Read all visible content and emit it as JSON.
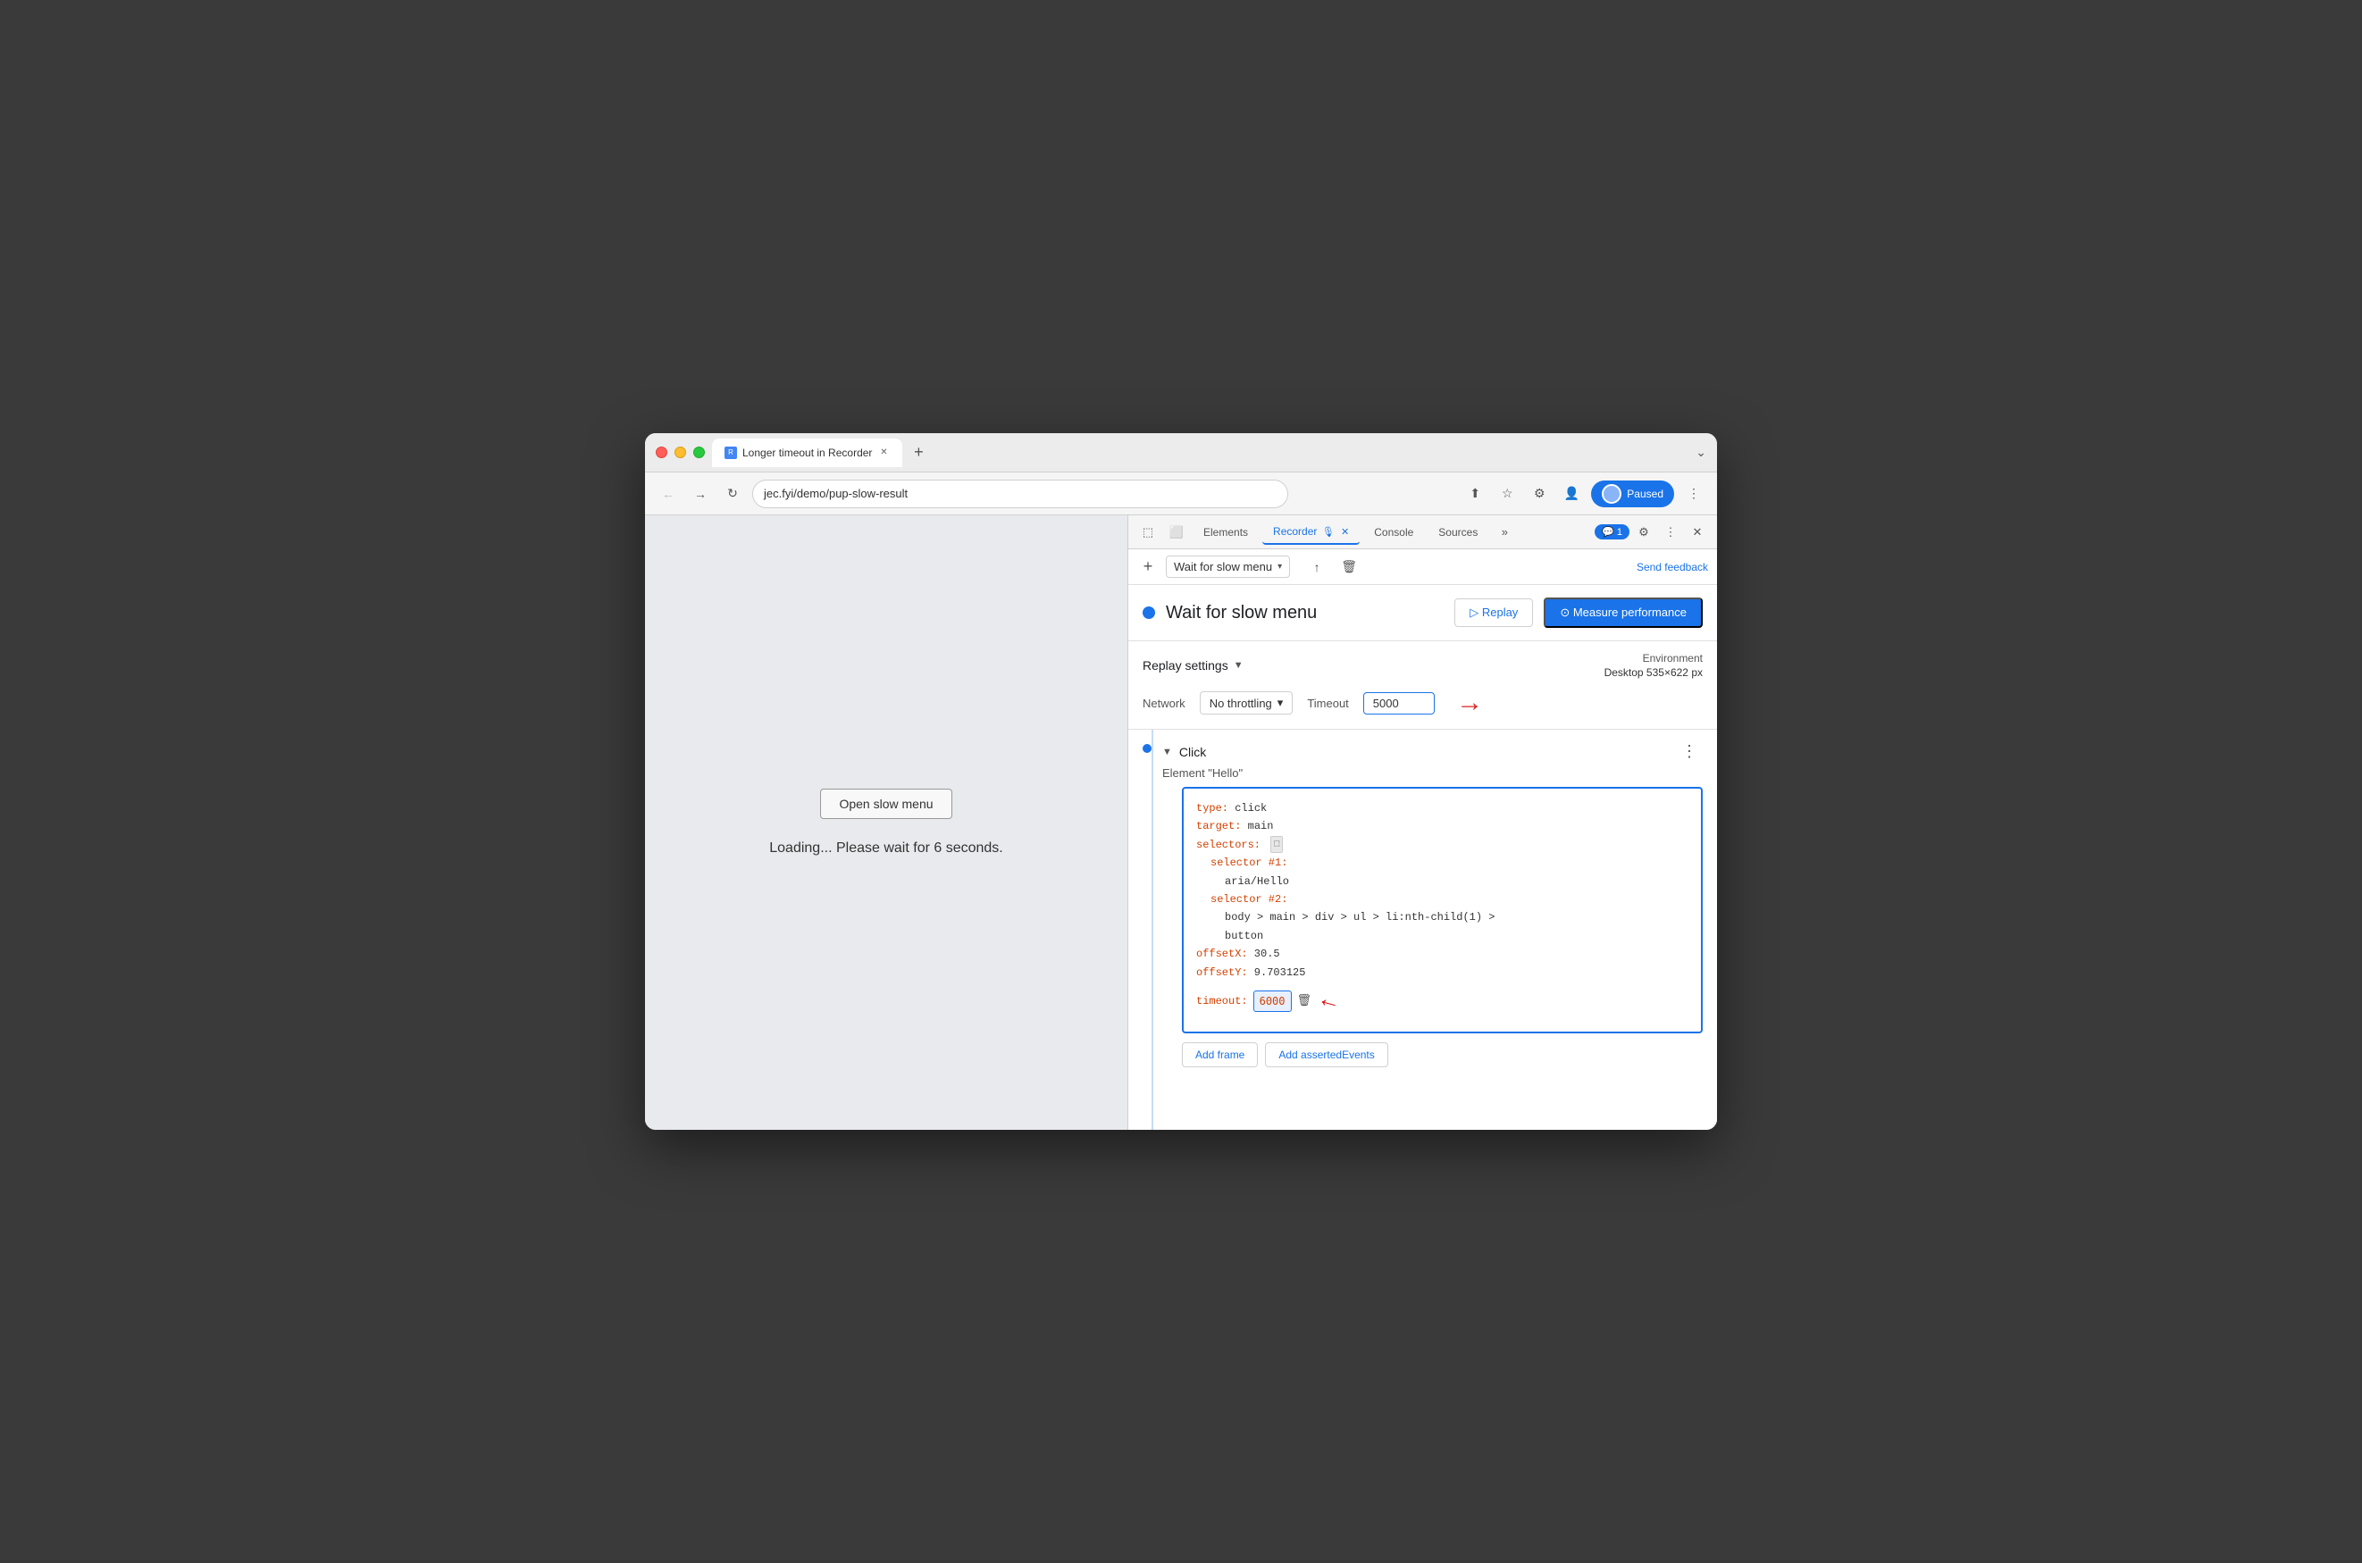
{
  "window": {
    "title": "Longer timeout in Recorder"
  },
  "browser": {
    "url": "jec.fyi/demo/pup-slow-result",
    "tab_title": "Longer timeout in Recorder",
    "paused_label": "Paused"
  },
  "page_content": {
    "open_menu_button": "Open slow menu",
    "loading_text": "Loading... Please wait for 6 seconds."
  },
  "devtools": {
    "tabs": [
      {
        "label": "Elements",
        "active": false
      },
      {
        "label": "Recorder",
        "active": true
      },
      {
        "label": "Console",
        "active": false
      },
      {
        "label": "Sources",
        "active": false
      }
    ],
    "feedback_badge": "💬 1",
    "more_tabs": "»"
  },
  "recorder": {
    "add_label": "+",
    "recording_name": "Wait for slow menu",
    "send_feedback": "Send feedback",
    "export_icon": "↑",
    "delete_icon": "🗑",
    "header": {
      "dot_color": "#1a73e8",
      "title": "Wait for slow menu",
      "replay_label": "▷  Replay",
      "measure_label": "⊙ Measure performance"
    },
    "replay_settings": {
      "title": "Replay settings",
      "arrow": "▼",
      "network_label": "Network",
      "network_value": "No throttling",
      "network_arrow": "▾",
      "timeout_label": "Timeout",
      "timeout_value": "5000"
    },
    "environment": {
      "title": "Environment",
      "value": "Desktop  535×622 px"
    },
    "step": {
      "type": "Click",
      "description": "Element \"Hello\"",
      "more_icon": "⋮",
      "code": {
        "type_key": "type:",
        "type_val": " click",
        "target_key": "target:",
        "target_val": " main",
        "selectors_key": "selectors:",
        "selector1_key": "selector #1:",
        "selector1_val": "aria/Hello",
        "selector2_key": "selector #2:",
        "selector2_val": "body > main > div > ul > li:nth-child(1) >",
        "selector2_val2": "button",
        "offsetx_key": "offsetX:",
        "offsetx_val": " 30.5",
        "offsety_key": "offsetY:",
        "offsety_val": " 9.703125",
        "timeout_key": "timeout:",
        "timeout_val": "6000"
      },
      "add_frame_btn": "Add frame",
      "add_asserted_btn": "Add assertedEvents"
    }
  }
}
